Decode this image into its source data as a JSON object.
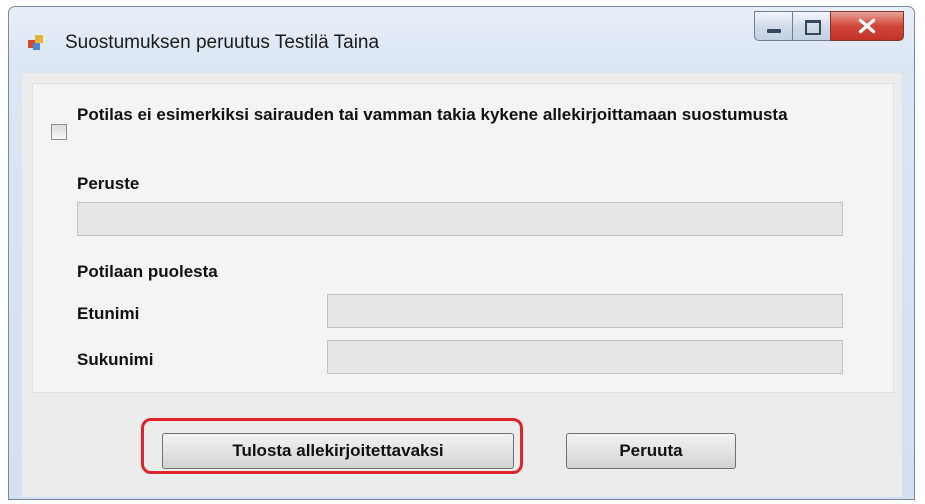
{
  "window": {
    "title": "Suostumuksen peruutus Testilä Taina",
    "app_icon": "app-icon"
  },
  "form": {
    "checkbox_label": "Potilas ei esimerkiksi sairauden tai vamman takia kykene allekirjoittamaan suostumusta",
    "checkbox_checked": false,
    "peruste_label": "Peruste",
    "peruste_value": "",
    "potilaan_puolesta_label": "Potilaan puolesta",
    "etunimi_label": "Etunimi",
    "etunimi_value": "",
    "sukunimi_label": "Sukunimi",
    "sukunimi_value": ""
  },
  "buttons": {
    "print_label": "Tulosta allekirjoitettavaksi",
    "cancel_label": "Peruuta"
  },
  "colors": {
    "highlight": "#e0242c",
    "close_button": "#c23226"
  }
}
